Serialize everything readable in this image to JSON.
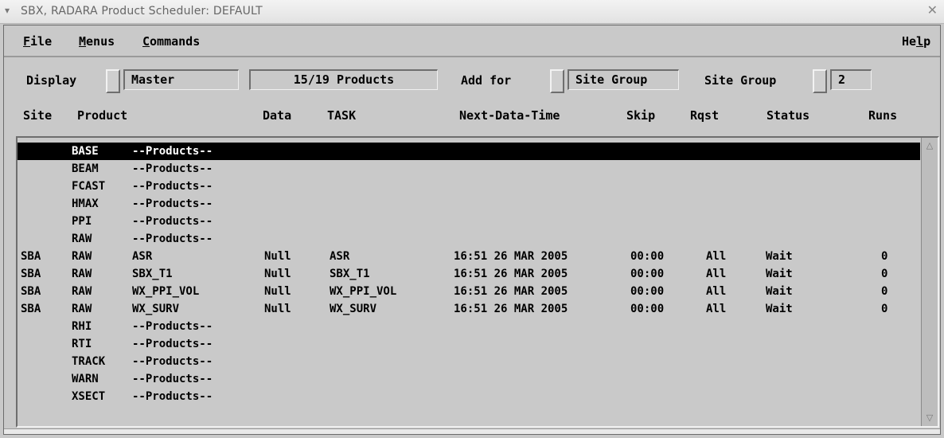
{
  "window": {
    "menu_icon": "▾",
    "title": "SBX, RADARA  Product Scheduler: DEFAULT",
    "close_glyph": "✕"
  },
  "menubar": {
    "file": {
      "mnemonic": "F",
      "rest": "ile"
    },
    "menus": {
      "mnemonic": "M",
      "rest": "enus"
    },
    "commands": {
      "mnemonic": "C",
      "rest": "ommands"
    },
    "help": {
      "prefix": "He",
      "mnemonic": "l",
      "rest": "p"
    }
  },
  "controls": {
    "display_label": "Display",
    "display_value": "Master",
    "products_count": "15/19 Products",
    "add_for_label": "Add for",
    "add_for_value": "Site Group",
    "site_group_label": "Site Group",
    "site_group_value": "2"
  },
  "columns": {
    "site": "Site",
    "product": "Product",
    "data": "Data",
    "task": "TASK",
    "next_data_time": "Next-Data-Time",
    "skip": "Skip",
    "rqst": "Rqst",
    "status": "Status",
    "runs": "Runs"
  },
  "rows": [
    {
      "site": "",
      "product": "BASE",
      "name": "--Products--",
      "data": "",
      "task": "",
      "next": "",
      "skip": "",
      "rqst": "",
      "status": "",
      "runs": "",
      "selected": true
    },
    {
      "site": "",
      "product": "BEAM",
      "name": "--Products--",
      "data": "",
      "task": "",
      "next": "",
      "skip": "",
      "rqst": "",
      "status": "",
      "runs": ""
    },
    {
      "site": "",
      "product": "FCAST",
      "name": "--Products--",
      "data": "",
      "task": "",
      "next": "",
      "skip": "",
      "rqst": "",
      "status": "",
      "runs": ""
    },
    {
      "site": "",
      "product": "HMAX",
      "name": "--Products--",
      "data": "",
      "task": "",
      "next": "",
      "skip": "",
      "rqst": "",
      "status": "",
      "runs": ""
    },
    {
      "site": "",
      "product": "PPI",
      "name": "--Products--",
      "data": "",
      "task": "",
      "next": "",
      "skip": "",
      "rqst": "",
      "status": "",
      "runs": ""
    },
    {
      "site": "",
      "product": "RAW",
      "name": "--Products--",
      "data": "",
      "task": "",
      "next": "",
      "skip": "",
      "rqst": "",
      "status": "",
      "runs": ""
    },
    {
      "site": "SBA",
      "product": "RAW",
      "name": "ASR",
      "data": "Null",
      "task": "ASR",
      "next": "16:51 26 MAR 2005",
      "skip": "00:00",
      "rqst": "All",
      "status": "Wait",
      "runs": "0"
    },
    {
      "site": "SBA",
      "product": "RAW",
      "name": "SBX_T1",
      "data": "Null",
      "task": "SBX_T1",
      "next": "16:51 26 MAR 2005",
      "skip": "00:00",
      "rqst": "All",
      "status": "Wait",
      "runs": "0"
    },
    {
      "site": "SBA",
      "product": "RAW",
      "name": "WX_PPI_VOL",
      "data": "Null",
      "task": "WX_PPI_VOL",
      "next": "16:51 26 MAR 2005",
      "skip": "00:00",
      "rqst": "All",
      "status": "Wait",
      "runs": "0"
    },
    {
      "site": "SBA",
      "product": "RAW",
      "name": "WX_SURV",
      "data": "Null",
      "task": "WX_SURV",
      "next": "16:51 26 MAR 2005",
      "skip": "00:00",
      "rqst": "All",
      "status": "Wait",
      "runs": "0"
    },
    {
      "site": "",
      "product": "RHI",
      "name": "--Products--",
      "data": "",
      "task": "",
      "next": "",
      "skip": "",
      "rqst": "",
      "status": "",
      "runs": ""
    },
    {
      "site": "",
      "product": "RTI",
      "name": "--Products--",
      "data": "",
      "task": "",
      "next": "",
      "skip": "",
      "rqst": "",
      "status": "",
      "runs": ""
    },
    {
      "site": "",
      "product": "TRACK",
      "name": "--Products--",
      "data": "",
      "task": "",
      "next": "",
      "skip": "",
      "rqst": "",
      "status": "",
      "runs": ""
    },
    {
      "site": "",
      "product": "WARN",
      "name": "--Products--",
      "data": "",
      "task": "",
      "next": "",
      "skip": "",
      "rqst": "",
      "status": "",
      "runs": ""
    },
    {
      "site": "",
      "product": "XSECT",
      "name": "--Products--",
      "data": "",
      "task": "",
      "next": "",
      "skip": "",
      "rqst": "",
      "status": "",
      "runs": ""
    }
  ],
  "scrollbar": {
    "up_icon": "△",
    "down_icon": "▽"
  }
}
